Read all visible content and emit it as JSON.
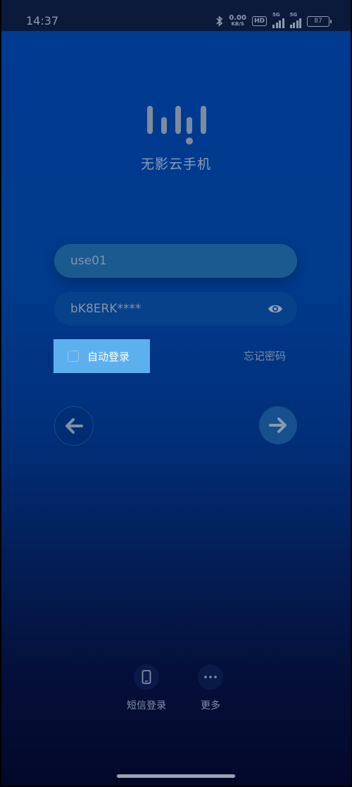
{
  "status_bar": {
    "time": "14:37",
    "net_speed_value": "0.00",
    "net_speed_unit": "KB/S",
    "hd_label": "HD",
    "sim1_label": "5G",
    "sim2_label": "5G",
    "battery": "87",
    "icons": [
      "bluetooth-icon",
      "hd-badge",
      "signal-5g-icon",
      "signal-5g-icon",
      "battery-icon"
    ]
  },
  "app": {
    "name": "无影云手机"
  },
  "login": {
    "username_value": "use01",
    "password_value": "bK8ERK****",
    "auto_login_label": "自动登录",
    "auto_login_checked": false,
    "forgot_password": "忘记密码"
  },
  "bottom_options": [
    {
      "label": "短信登录",
      "icon": "phone-icon"
    },
    {
      "label": "更多",
      "icon": "more-icon"
    }
  ],
  "colors": {
    "background_top": "#003a92",
    "background_bottom": "#03082a",
    "auto_login_bg": "#5cb0ee",
    "input_bg": "#1a5a8f"
  }
}
